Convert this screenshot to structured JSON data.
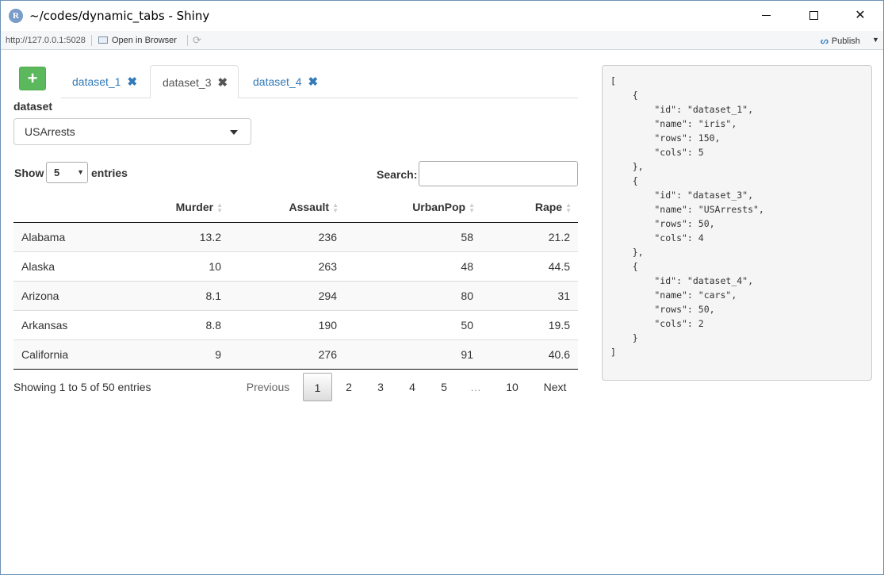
{
  "window": {
    "title": "~/codes/dynamic_tabs - Shiny",
    "app_icon": "R"
  },
  "toolbar": {
    "url": "http://127.0.0.1:5028",
    "open_browser": "Open in Browser",
    "publish": "Publish"
  },
  "tabs": [
    {
      "label": "dataset_1",
      "active": false
    },
    {
      "label": "dataset_3",
      "active": true
    },
    {
      "label": "dataset_4",
      "active": false
    }
  ],
  "add_button": "+",
  "dataset_input": {
    "label": "dataset",
    "value": "USArrests"
  },
  "length": {
    "show": "Show",
    "value": "5",
    "entries": "entries"
  },
  "search": {
    "label": "Search:",
    "value": ""
  },
  "table": {
    "columns": [
      "",
      "Murder",
      "Assault",
      "UrbanPop",
      "Rape"
    ],
    "rows": [
      [
        "Alabama",
        "13.2",
        "236",
        "58",
        "21.2"
      ],
      [
        "Alaska",
        "10",
        "263",
        "48",
        "44.5"
      ],
      [
        "Arizona",
        "8.1",
        "294",
        "80",
        "31"
      ],
      [
        "Arkansas",
        "8.8",
        "190",
        "50",
        "19.5"
      ],
      [
        "California",
        "9",
        "276",
        "91",
        "40.6"
      ]
    ]
  },
  "info": "Showing 1 to 5 of 50 entries",
  "pagination": {
    "previous": "Previous",
    "pages": [
      "1",
      "2",
      "3",
      "4",
      "5",
      "…",
      "10"
    ],
    "next": "Next",
    "current": "1"
  },
  "json_output": "[\n    {\n        \"id\": \"dataset_1\",\n        \"name\": \"iris\",\n        \"rows\": 150,\n        \"cols\": 5\n    },\n    {\n        \"id\": \"dataset_3\",\n        \"name\": \"USArrests\",\n        \"rows\": 50,\n        \"cols\": 4\n    },\n    {\n        \"id\": \"dataset_4\",\n        \"name\": \"cars\",\n        \"rows\": 50,\n        \"cols\": 2\n    }\n]",
  "colors": {
    "add_button": "#5cb85c",
    "link": "#337ab7",
    "window_border": "#6d8fb3"
  }
}
